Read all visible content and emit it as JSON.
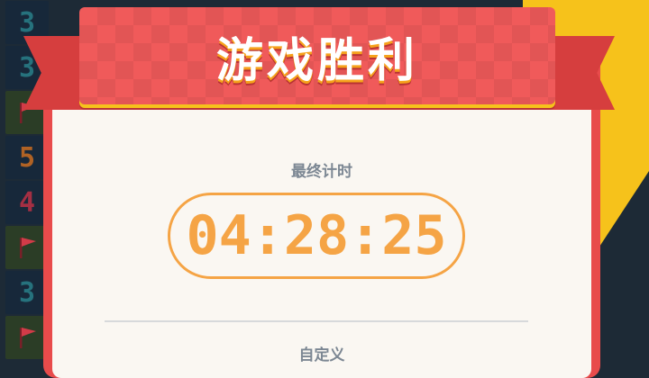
{
  "board": {
    "cells": [
      {
        "type": "number",
        "text": "3",
        "color": "#26727d"
      },
      {
        "type": "number",
        "text": "3",
        "color": "#26727d"
      },
      {
        "type": "flag",
        "icon": "flag-icon"
      },
      {
        "type": "number",
        "text": "5",
        "color": "#b06224"
      },
      {
        "type": "number",
        "text": "4",
        "color": "#a42f43"
      },
      {
        "type": "flag",
        "icon": "flag-icon"
      },
      {
        "type": "number",
        "text": "3",
        "color": "#26727d"
      },
      {
        "type": "flag",
        "icon": "flag-icon"
      }
    ]
  },
  "ribbon": {
    "title": "游戏胜利"
  },
  "result": {
    "time_label": "最终计时",
    "time_value": "04:28:25",
    "mode_label": "自定义"
  },
  "colors": {
    "accent": "#f5a445",
    "ribbon": "#f05a5a",
    "card_border": "#e84b4b",
    "background_yellow": "#f6c21b"
  }
}
